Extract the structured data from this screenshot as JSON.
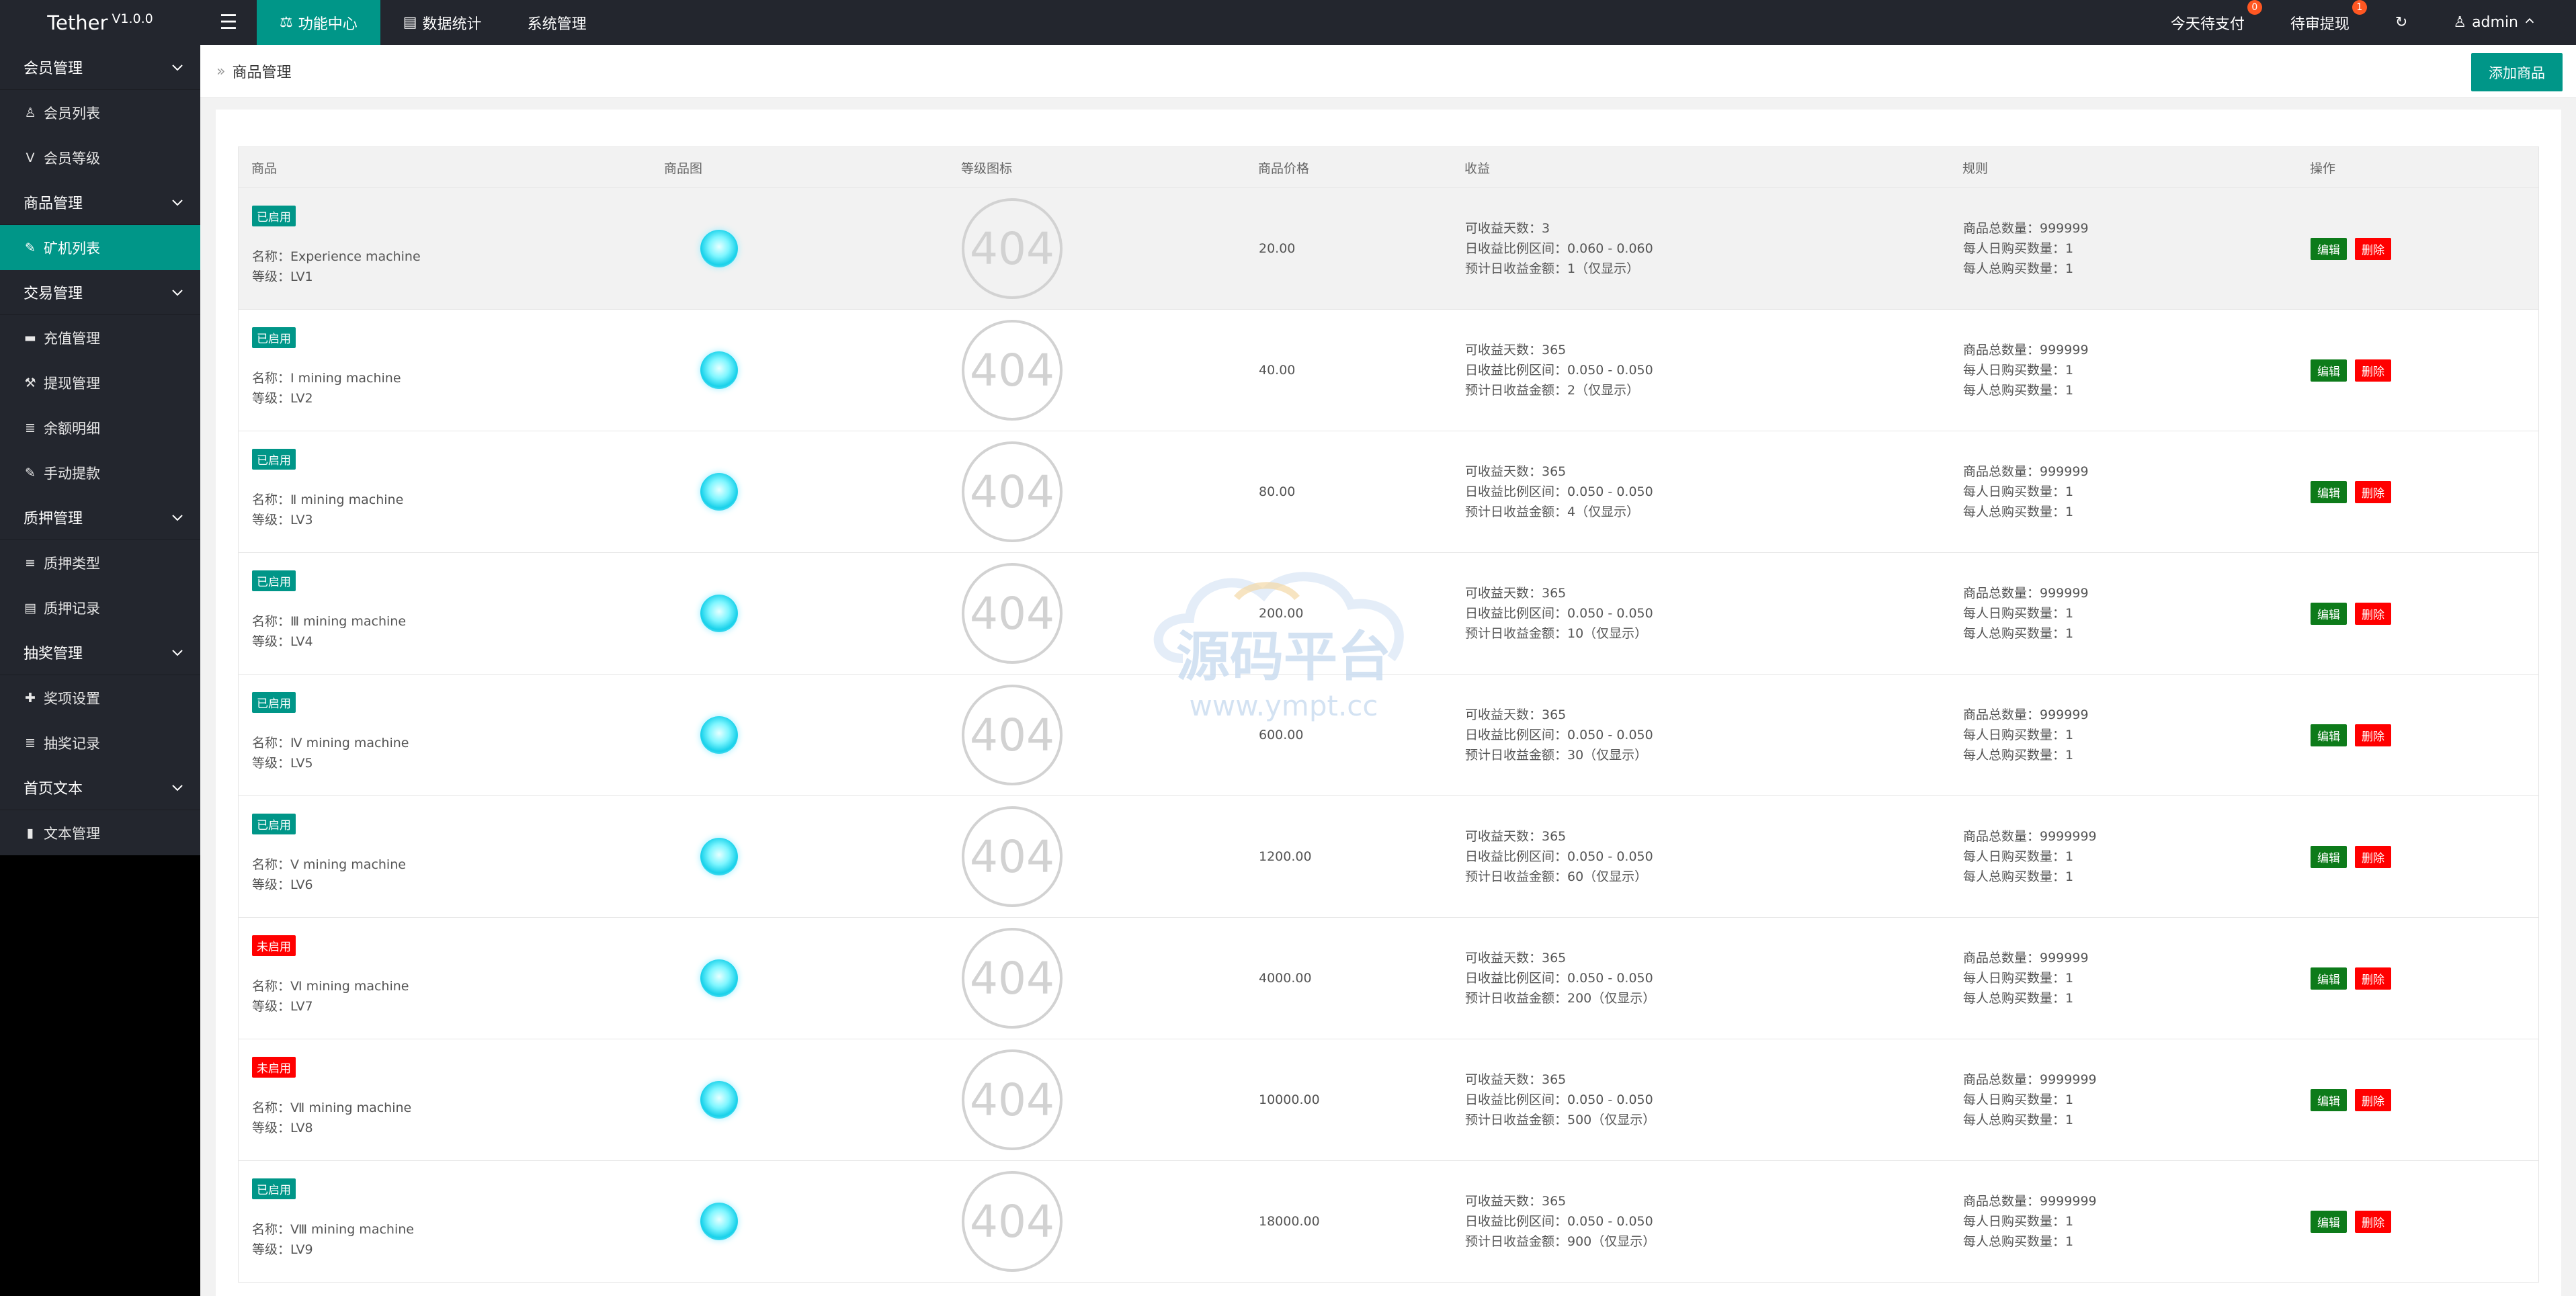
{
  "header": {
    "brand": "Tether",
    "version": "V1.0.0",
    "nav": [
      {
        "label": "功能中心",
        "icon": "layers-icon",
        "active": true
      },
      {
        "label": "数据统计",
        "icon": "table-icon",
        "active": false
      },
      {
        "label": "系统管理",
        "icon": "",
        "active": false
      }
    ],
    "right": [
      {
        "label": "今天待支付",
        "badge": "0"
      },
      {
        "label": "待审提现",
        "badge": "1"
      },
      {
        "label": "",
        "icon": "refresh-icon",
        "badge": ""
      },
      {
        "label": "admin",
        "icon": "user-icon",
        "badge": ""
      }
    ]
  },
  "sidebar": [
    {
      "type": "group",
      "label": "会员管理"
    },
    {
      "type": "item",
      "label": "会员列表",
      "icon": "user-icon",
      "glyph": "♙"
    },
    {
      "type": "item",
      "label": "会员等级",
      "icon": "vimeo-icon",
      "glyph": "V"
    },
    {
      "type": "group",
      "label": "商品管理"
    },
    {
      "type": "item",
      "label": "矿机列表",
      "icon": "edit-icon",
      "glyph": "✎",
      "active": true
    },
    {
      "type": "group",
      "label": "交易管理"
    },
    {
      "type": "item",
      "label": "充值管理",
      "icon": "comment-icon",
      "glyph": "▬"
    },
    {
      "type": "item",
      "label": "提现管理",
      "icon": "gavel-icon",
      "glyph": "⚒"
    },
    {
      "type": "item",
      "label": "余额明细",
      "icon": "list-icon",
      "glyph": "≣"
    },
    {
      "type": "item",
      "label": "手动提款",
      "icon": "edit-icon",
      "glyph": "✎"
    },
    {
      "type": "group",
      "label": "质押管理"
    },
    {
      "type": "item",
      "label": "质押类型",
      "icon": "align-icon",
      "glyph": "≡"
    },
    {
      "type": "item",
      "label": "质押记录",
      "icon": "table-icon",
      "glyph": "▤"
    },
    {
      "type": "group",
      "label": "抽奖管理"
    },
    {
      "type": "item",
      "label": "奖项设置",
      "icon": "puzzle-icon",
      "glyph": "✚"
    },
    {
      "type": "item",
      "label": "抽奖记录",
      "icon": "list-icon",
      "glyph": "≣"
    },
    {
      "type": "group",
      "label": "首页文本"
    },
    {
      "type": "item",
      "label": "文本管理",
      "icon": "book-icon",
      "glyph": "▮"
    }
  ],
  "breadcrumb": {
    "label": "商品管理"
  },
  "add_button": "添加商品",
  "table": {
    "headers": [
      "商品",
      "商品图",
      "等级图标",
      "商品价格",
      "收益",
      "规则",
      "操作"
    ],
    "edit_label": "编辑",
    "delete_label": "删除",
    "image_placeholder": "404",
    "rows": [
      {
        "status": "已启用",
        "on": true,
        "name": "名称：Experience machine",
        "level": "等级：LV1",
        "price": "20.00",
        "income": [
          "可收益天数：3",
          "日收益比例区间：0.060 - 0.060",
          "预计日收益金额：1（仅显示）"
        ],
        "rules": [
          "商品总数量：999999",
          "每人日购买数量：1",
          "每人总购买数量：1"
        ]
      },
      {
        "status": "已启用",
        "on": true,
        "name": "名称：Ⅰ mining machine",
        "level": "等级：LV2",
        "price": "40.00",
        "income": [
          "可收益天数：365",
          "日收益比例区间：0.050 - 0.050",
          "预计日收益金额：2（仅显示）"
        ],
        "rules": [
          "商品总数量：999999",
          "每人日购买数量：1",
          "每人总购买数量：1"
        ]
      },
      {
        "status": "已启用",
        "on": true,
        "name": "名称：Ⅱ mining machine",
        "level": "等级：LV3",
        "price": "80.00",
        "income": [
          "可收益天数：365",
          "日收益比例区间：0.050 - 0.050",
          "预计日收益金额：4（仅显示）"
        ],
        "rules": [
          "商品总数量：999999",
          "每人日购买数量：1",
          "每人总购买数量：1"
        ]
      },
      {
        "status": "已启用",
        "on": true,
        "name": "名称：Ⅲ mining machine",
        "level": "等级：LV4",
        "price": "200.00",
        "income": [
          "可收益天数：365",
          "日收益比例区间：0.050 - 0.050",
          "预计日收益金额：10（仅显示）"
        ],
        "rules": [
          "商品总数量：999999",
          "每人日购买数量：1",
          "每人总购买数量：1"
        ]
      },
      {
        "status": "已启用",
        "on": true,
        "name": "名称：Ⅳ mining machine",
        "level": "等级：LV5",
        "price": "600.00",
        "income": [
          "可收益天数：365",
          "日收益比例区间：0.050 - 0.050",
          "预计日收益金额：30（仅显示）"
        ],
        "rules": [
          "商品总数量：999999",
          "每人日购买数量：1",
          "每人总购买数量：1"
        ]
      },
      {
        "status": "已启用",
        "on": true,
        "name": "名称：Ⅴ mining machine",
        "level": "等级：LV6",
        "price": "1200.00",
        "income": [
          "可收益天数：365",
          "日收益比例区间：0.050 - 0.050",
          "预计日收益金额：60（仅显示）"
        ],
        "rules": [
          "商品总数量：9999999",
          "每人日购买数量：1",
          "每人总购买数量：1"
        ]
      },
      {
        "status": "未启用",
        "on": false,
        "name": "名称：Ⅵ mining machine",
        "level": "等级：LV7",
        "price": "4000.00",
        "income": [
          "可收益天数：365",
          "日收益比例区间：0.050 - 0.050",
          "预计日收益金额：200（仅显示）"
        ],
        "rules": [
          "商品总数量：999999",
          "每人日购买数量：1",
          "每人总购买数量：1"
        ]
      },
      {
        "status": "未启用",
        "on": false,
        "name": "名称：Ⅶ mining machine",
        "level": "等级：LV8",
        "price": "10000.00",
        "income": [
          "可收益天数：365",
          "日收益比例区间：0.050 - 0.050",
          "预计日收益金额：500（仅显示）"
        ],
        "rules": [
          "商品总数量：9999999",
          "每人日购买数量：1",
          "每人总购买数量：1"
        ]
      },
      {
        "status": "已启用",
        "on": true,
        "name": "名称：Ⅷ mining machine",
        "level": "等级：LV9",
        "price": "18000.00",
        "income": [
          "可收益天数：365",
          "日收益比例区间：0.050 - 0.050",
          "预计日收益金额：900（仅显示）"
        ],
        "rules": [
          "商品总数量：9999999",
          "每人日购买数量：1",
          "每人总购买数量：1"
        ]
      }
    ]
  },
  "watermark": {
    "title": "源码平台",
    "url": "www.ympt.cc"
  }
}
